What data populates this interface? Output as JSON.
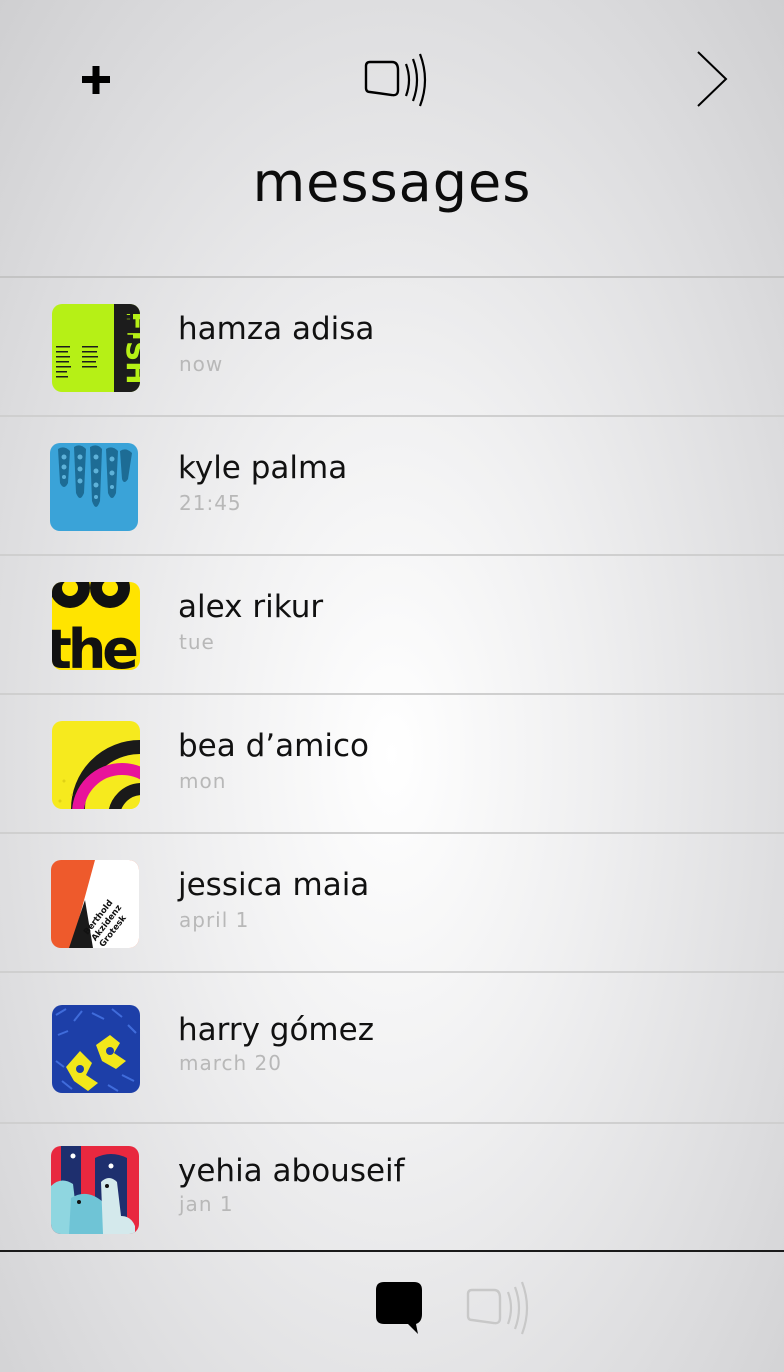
{
  "header": {
    "title": "messages",
    "add_icon": "plus-icon",
    "signal_icon": "signal-icon",
    "next_icon": "chevron-right-icon"
  },
  "conversations": [
    {
      "name": "hamza adisa",
      "time": "now"
    },
    {
      "name": "kyle palma",
      "time": "21:45"
    },
    {
      "name": "alex rikur",
      "time": "tue"
    },
    {
      "name": "bea d’amico",
      "time": "mon"
    },
    {
      "name": "jessica maia",
      "time": "april 1"
    },
    {
      "name": "harry gómez",
      "time": "march 20"
    },
    {
      "name": "yehia abouseif",
      "time": "jan 1"
    }
  ],
  "avatar_text": {
    "hamza_fish": "FISH",
    "hamza_th": "TH",
    "alex_the": "the",
    "jessica_l1": "Berthold",
    "jessica_l2": "Akzidenz",
    "jessica_l3": "Grotesk"
  },
  "tabbar": {
    "messages_icon": "speech-bubble-icon",
    "signal_icon": "signal-icon"
  },
  "colors": {
    "text": "#111111",
    "subtle": "#b8b8b8",
    "active_tab": "#000000",
    "inactive_tab": "#c8c8c8"
  }
}
